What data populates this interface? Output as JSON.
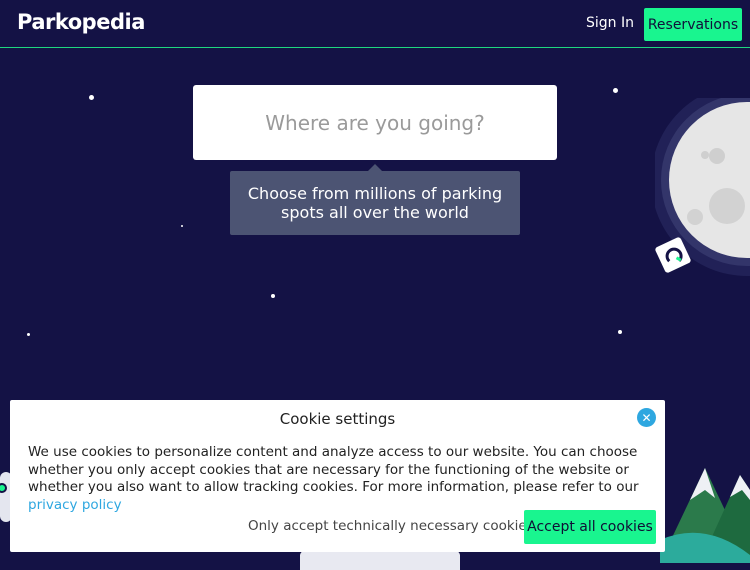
{
  "header": {
    "logo_text": "Parkopedia",
    "sign_in_label": "Sign In",
    "reservations_label": "Reservations"
  },
  "search": {
    "placeholder": "Where are you going?"
  },
  "tooltip": {
    "text": "Choose from millions of parking spots all over the world"
  },
  "cookie_banner": {
    "title": "Cookie settings",
    "close_icon": "close-icon",
    "body_text": "We use cookies to personalize content and analyze access to our website. You can choose whether you only accept cookies that are necessary for the functioning of the website or whether you also want to allow tracking cookies. For more information, please refer to our",
    "privacy_link_label": "privacy policy",
    "only_necessary_label": "Only accept technically necessary cookies",
    "accept_all_label": "Accept all cookies"
  },
  "colors": {
    "background": "#141245",
    "accent_green": "#19f58f",
    "link_blue": "#2ea7e0",
    "tooltip_bg": "#4c5473"
  }
}
